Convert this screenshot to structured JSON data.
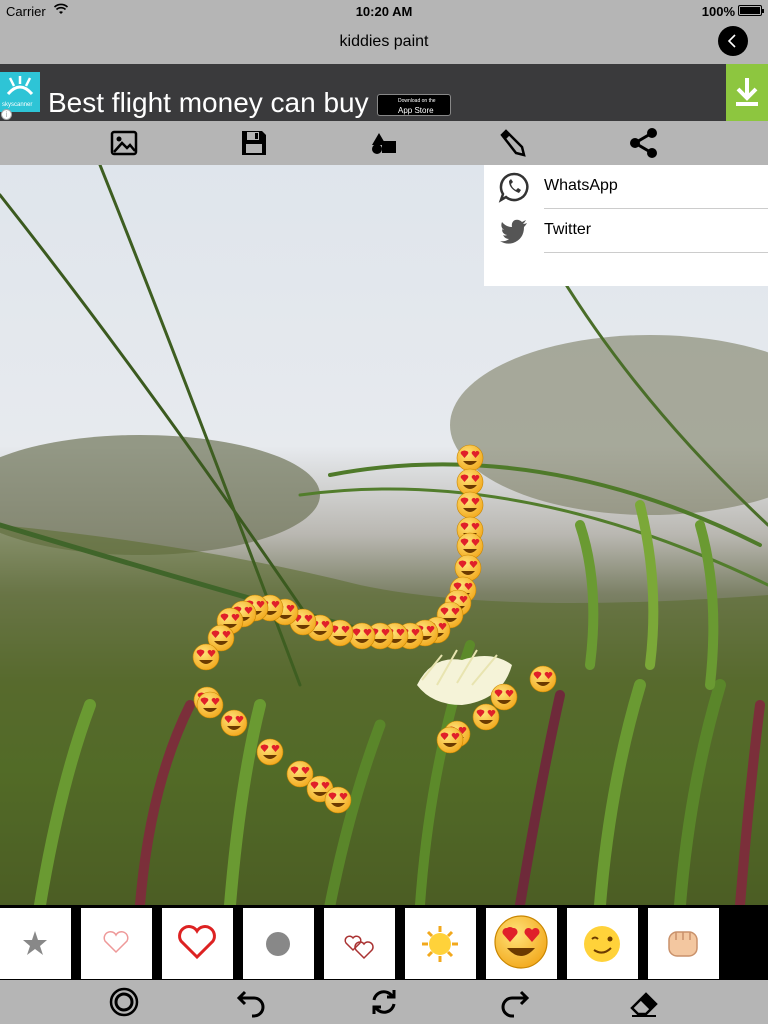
{
  "status_bar": {
    "carrier": "Carrier",
    "time": "10:20 AM",
    "battery": "100%"
  },
  "navbar": {
    "title": "kiddies paint",
    "back_icon": "chevron-left-icon"
  },
  "ad": {
    "headline": "Best flight money can buy",
    "logo_text": "skyscanner",
    "appstore_small": "Download on the",
    "appstore_label": "App Store",
    "download_color": "#8dc63f"
  },
  "toolbar": {
    "icons": [
      "image-icon",
      "save-icon",
      "shapes-icon",
      "pencil-icon",
      "share-icon"
    ]
  },
  "share_menu": {
    "items": [
      {
        "label": "WhatsApp",
        "icon": "whatsapp-icon"
      },
      {
        "label": "Twitter",
        "icon": "twitter-icon"
      }
    ]
  },
  "brushes": [
    "star",
    "heart-outline-thin",
    "heart-outline-red",
    "circle",
    "double-heart",
    "sun",
    "heart-eyes-emoji",
    "wink-emoji",
    "fist-emoji"
  ],
  "bottom_bar": {
    "icons": [
      "brush-size-icon",
      "undo-icon",
      "refresh-icon",
      "redo-icon",
      "eraser-icon"
    ]
  }
}
